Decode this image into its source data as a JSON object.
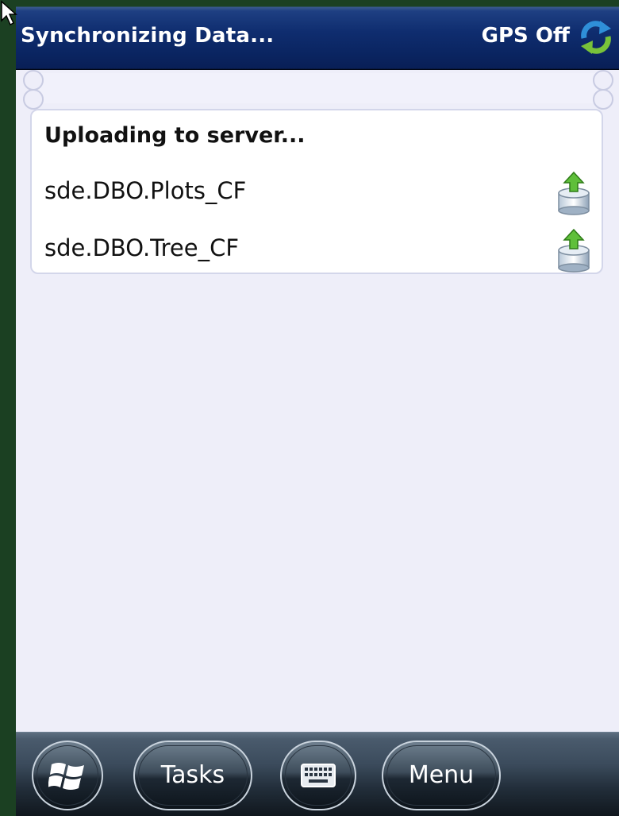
{
  "titlebar": {
    "title": "Synchronizing Data...",
    "gps_status": "GPS Off",
    "sync_icon": "sync-arrows-icon"
  },
  "upload_panel": {
    "heading": "Uploading to server...",
    "items": [
      {
        "label": "sde.DBO.Plots_CF",
        "icon": "database-upload-icon"
      },
      {
        "label": "sde.DBO.Tree_CF",
        "icon": "database-upload-icon"
      }
    ]
  },
  "taskbar": {
    "start_icon": "windows-logo-icon",
    "tasks_label": "Tasks",
    "keyboard_icon": "keyboard-icon",
    "menu_label": "Menu"
  },
  "colors": {
    "titlebar": "#0f2d6f",
    "content_bg": "#eeeef9",
    "card_bg": "#ffffff",
    "taskbar": "#3b4b5c",
    "frame": "#1b4022"
  }
}
